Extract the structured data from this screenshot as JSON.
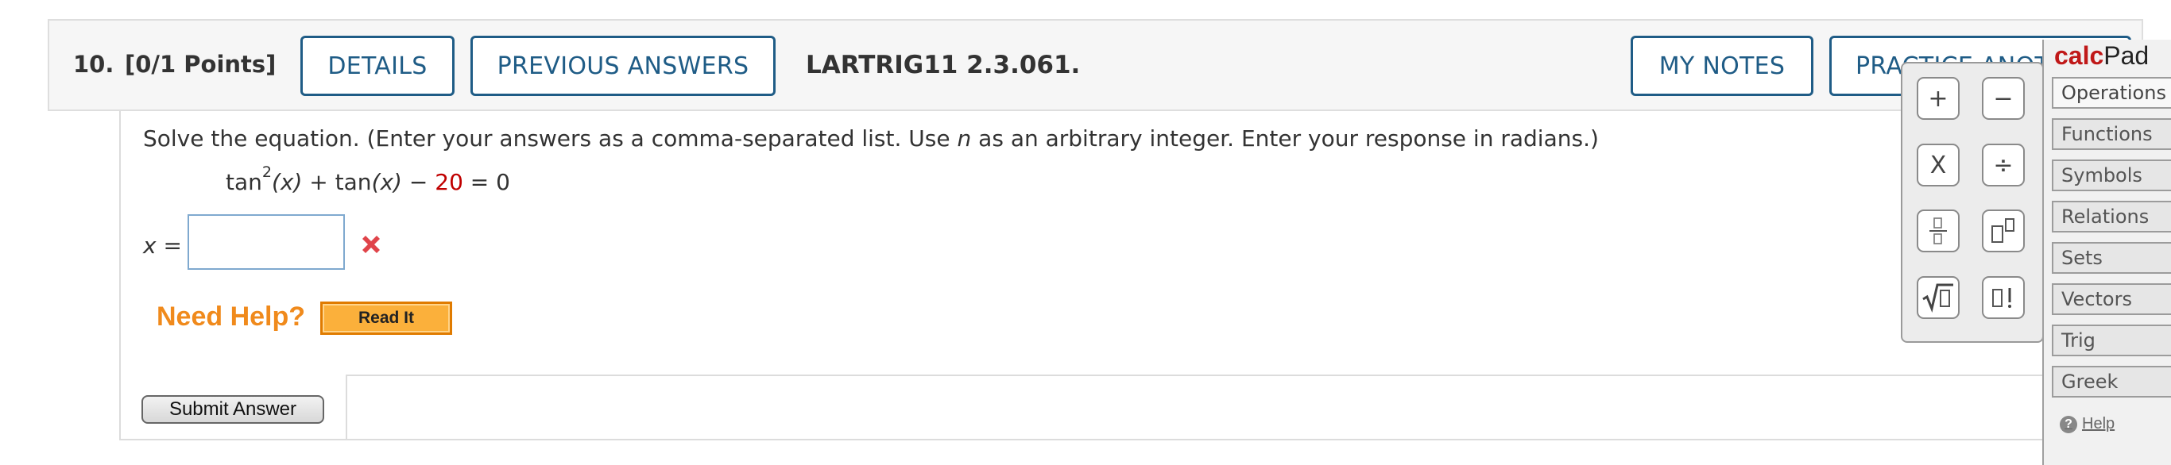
{
  "question": {
    "number": "10.",
    "points": "[0/1 Points]",
    "code": "LARTRIG11 2.3.061."
  },
  "header_buttons": {
    "details": "DETAILS",
    "previous_answers": "PREVIOUS ANSWERS",
    "my_notes": "MY NOTES",
    "practice_another": "PRACTICE ANOTHER"
  },
  "instructions": {
    "part1": "Solve the equation. (Enter your answers as a comma-separated list. Use ",
    "var": "n",
    "part2": " as an arbitrary integer. Enter your response in radians.)"
  },
  "equation": {
    "fn1": "tan",
    "exp": "2",
    "arg1": "(x)",
    "plus": " + tan",
    "arg2": "(x)",
    "minus": " − ",
    "const": "20",
    "rhs": " = 0"
  },
  "answer": {
    "var": "x",
    "eq": " =",
    "value": "",
    "status": "incorrect"
  },
  "help": {
    "label": "Need Help?",
    "read_it": "Read It"
  },
  "submit_label": "Submit Answer",
  "calcpad": {
    "title_bold": "calc",
    "title_rest": "Pad",
    "buttons": [
      "+",
      "−",
      "X",
      "÷",
      "▯/▯",
      "▯▯",
      "√▯",
      "▯!"
    ],
    "tabs": [
      "Operations",
      "Functions",
      "Symbols",
      "Relations",
      "Sets",
      "Vectors",
      "Trig",
      "Greek"
    ],
    "active_tab": "Operations",
    "help": "Help"
  },
  "colors": {
    "accent": "#1f5c86",
    "error": "#e0444a",
    "help_orange": "#f08a1c",
    "constant_red": "#c00000"
  }
}
